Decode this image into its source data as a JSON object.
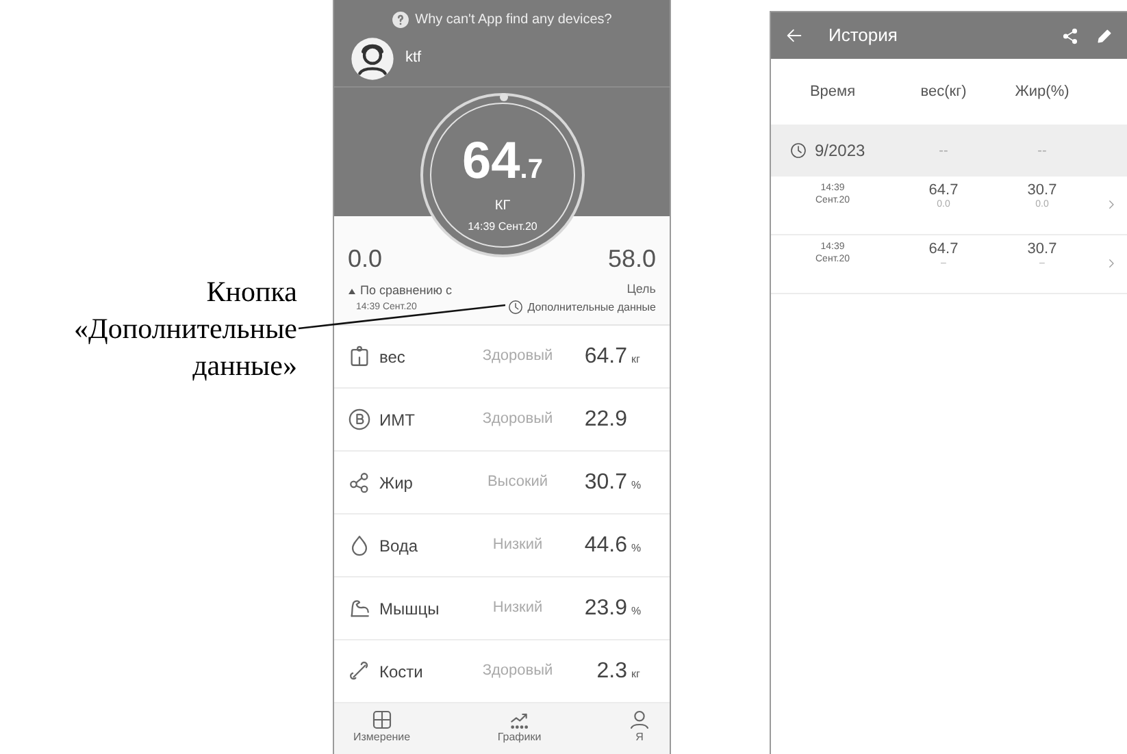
{
  "annotation": {
    "text": "Кнопка «Дополнительные данные»"
  },
  "home": {
    "help_text": "Why can't App find any devices?",
    "user_name": "ktf",
    "weight_integer": "64",
    "weight_decimal": ".7",
    "unit": "КГ",
    "time": "14:39 Сент.20",
    "change": "0.0",
    "compared_label": "По сравнению с",
    "compared_time": "14:39 Сент.20",
    "goal": "58.0",
    "goal_label": "Цель",
    "more_data_button": "Дополнительные данные",
    "metrics": [
      {
        "kind": "scale",
        "name": "вес",
        "status": "Здоровый",
        "value": "64.7",
        "unit": "кг"
      },
      {
        "kind": "bmi",
        "name": "ИМТ",
        "status": "Здоровый",
        "value": "22.9"
      },
      {
        "kind": "fat",
        "name": "Жир",
        "status": "Высокий",
        "value": "30.7",
        "unit": "%"
      },
      {
        "kind": "water",
        "name": "Вода",
        "status": "Низкий",
        "value": "44.6",
        "unit": "%"
      },
      {
        "kind": "muscle",
        "name": "Мышцы",
        "status": "Низкий",
        "value": "23.9",
        "unit": "%"
      },
      {
        "kind": "bone",
        "name": "Кости",
        "status": "Здоровый",
        "value": "2.3",
        "unit": "кг"
      }
    ],
    "nav": [
      {
        "kind": "grid",
        "label": "Измерение"
      },
      {
        "kind": "chart",
        "label": "Графики"
      },
      {
        "kind": "person",
        "label": "Я"
      }
    ]
  },
  "history": {
    "title": "История",
    "columns": [
      "Время",
      "вес(кг)",
      "Жир(%)"
    ],
    "month": {
      "label": "9/2023",
      "weight": "--",
      "fat": "--"
    },
    "rows": [
      {
        "time": "14:39",
        "date": "Сент.20",
        "weight": "64.7",
        "weight_change": "0.0",
        "fat": "30.7",
        "fat_change": "0.0"
      },
      {
        "time": "14:39",
        "date": "Сент.20",
        "weight": "64.7",
        "weight_change": "–",
        "fat": "30.7",
        "fat_change": "–"
      }
    ]
  }
}
